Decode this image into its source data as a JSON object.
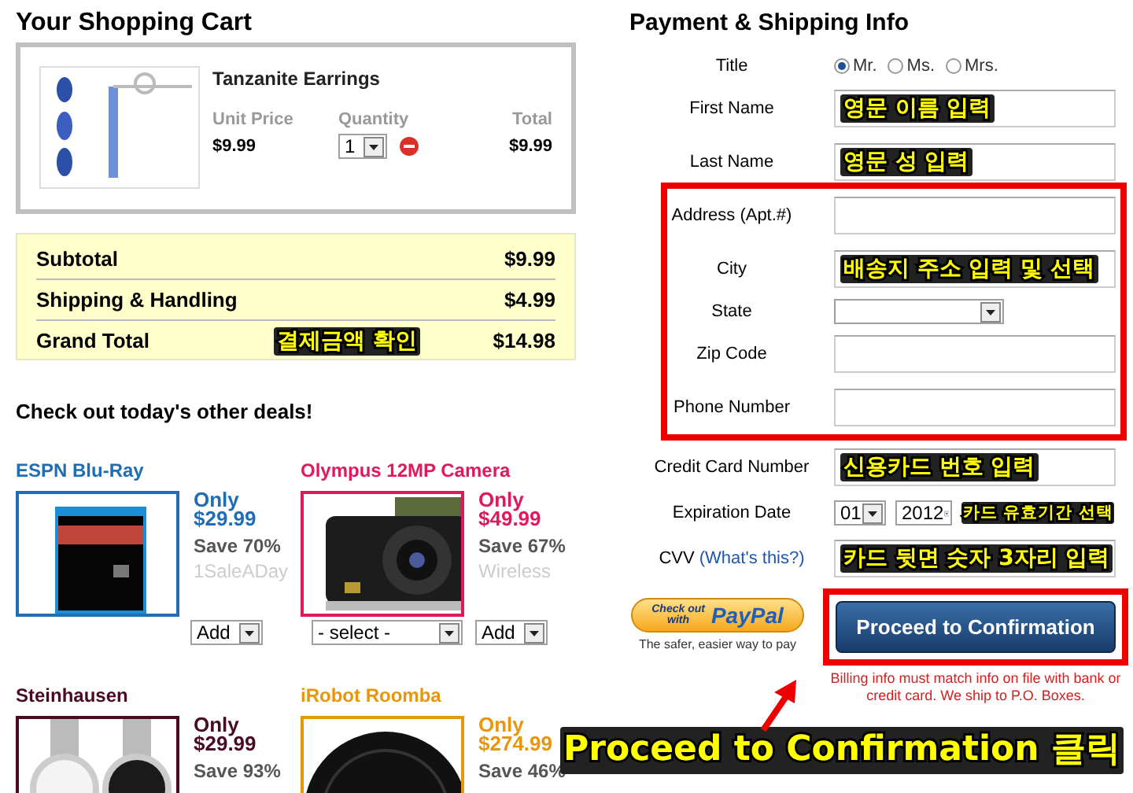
{
  "cart": {
    "title": "Your Shopping Cart",
    "item": {
      "name": "Tanzanite Earrings",
      "unit_price_label": "Unit Price",
      "unit_price": "$9.99",
      "quantity_label": "Quantity",
      "quantity": "1",
      "total_label": "Total",
      "total": "$9.99"
    },
    "summary": [
      {
        "label": "Subtotal",
        "value": "$9.99"
      },
      {
        "label": "Shipping & Handling",
        "value": "$4.99"
      },
      {
        "label": "Grand Total",
        "value": "$14.98",
        "annotation": "결제금액 확인"
      }
    ]
  },
  "deals": {
    "title": "Check out today's other deals!",
    "items": [
      {
        "name": "ESPN Blu-Ray",
        "color": "#1f6db5",
        "only": "Only",
        "price": "$29.99",
        "save": "Save 70%",
        "source": "1SaleADay",
        "controls": [
          {
            "kind": "add",
            "value": "Add"
          }
        ]
      },
      {
        "name": "Olympus 12MP Camera",
        "color": "#e0195e",
        "only": "Only",
        "price": "$49.99",
        "save": "Save 67%",
        "source": "Wireless",
        "controls": [
          {
            "kind": "dropdown",
            "value": "- select -"
          },
          {
            "kind": "add",
            "value": "Add"
          }
        ]
      },
      {
        "name": "Steinhausen",
        "color": "#4a0a24",
        "only": "Only",
        "price": "$29.99",
        "save": "Save 93%"
      },
      {
        "name": "iRobot Roomba",
        "color": "#e8960c",
        "only": "Only",
        "price": "$274.99",
        "save": "Save 46%"
      }
    ]
  },
  "payment": {
    "title": "Payment & Shipping Info",
    "title_label": "Title",
    "title_options": [
      {
        "label": "Mr.",
        "selected": true
      },
      {
        "label": "Ms.",
        "selected": false
      },
      {
        "label": "Mrs.",
        "selected": false
      }
    ],
    "fields": [
      {
        "label": "First Name",
        "kind": "text",
        "highlighted": false,
        "annotation": "영문 이름 입력"
      },
      {
        "label": "Last Name",
        "kind": "text",
        "highlighted": false,
        "annotation": "영문 성 입력"
      },
      {
        "label": "Address (Apt.#)",
        "kind": "text",
        "highlighted": true
      },
      {
        "label": "City",
        "kind": "text",
        "highlighted": true,
        "annotation": "배송지 주소 입력 및 선택"
      },
      {
        "label": "State",
        "kind": "select",
        "highlighted": true
      },
      {
        "label": "Zip Code",
        "kind": "text",
        "highlighted": true
      },
      {
        "label": "Phone Number",
        "kind": "text",
        "highlighted": true
      },
      {
        "label": "Credit Card Number",
        "kind": "text",
        "highlighted": false,
        "annotation": "신용카드 번호 입력"
      },
      {
        "label": "Expiration Date",
        "kind": "date",
        "highlighted": false,
        "month": "01",
        "year": "2012",
        "annotation": "카드 유효기간 선택"
      },
      {
        "label": "CVV",
        "link": "(What's this?)",
        "kind": "text",
        "highlighted": false,
        "annotation": "카드 뒷면 숫자 3자리 입력"
      }
    ],
    "paypal": {
      "check_out": "Check out",
      "with": "with",
      "brand": "PayPal",
      "tagline": "The safer, easier way to pay"
    },
    "proceed": {
      "label": "Proceed to Confirmation",
      "highlighted": true
    },
    "note": "Billing info must match info on file with bank or credit card. We ship to P.O. Boxes.",
    "callout": "Proceed to Confirmation 클릭"
  }
}
